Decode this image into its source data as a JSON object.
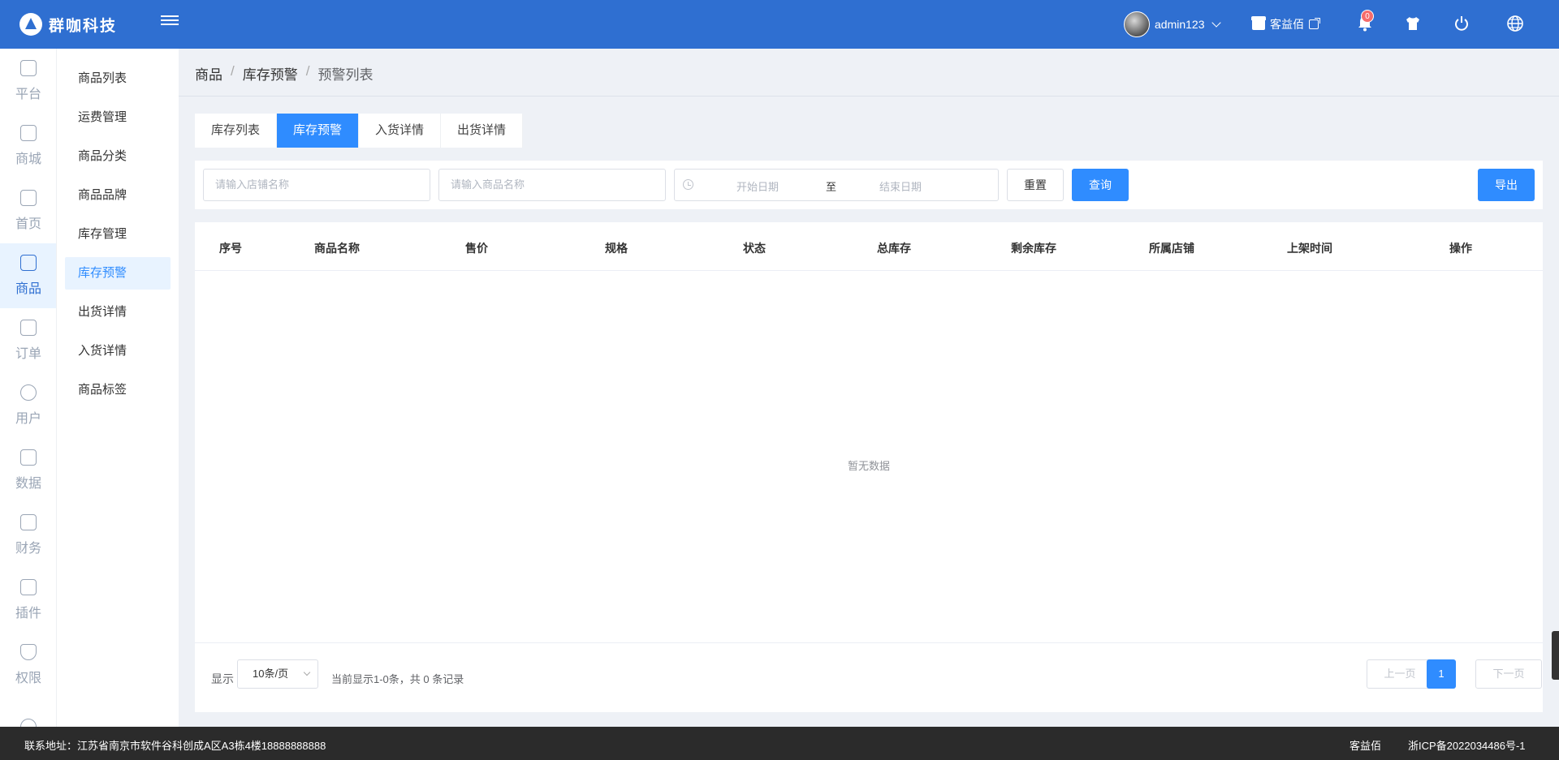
{
  "header": {
    "logo_text": "群咖科技",
    "username": "admin123",
    "store_name": "客益佰",
    "notification_count": "0"
  },
  "nav": [
    {
      "label": "平台",
      "icon": "platform-icon"
    },
    {
      "label": "商城",
      "icon": "mall-icon"
    },
    {
      "label": "首页",
      "icon": "home-icon"
    },
    {
      "label": "商品",
      "icon": "goods-icon",
      "active": true
    },
    {
      "label": "订单",
      "icon": "order-icon"
    },
    {
      "label": "用户",
      "icon": "user-icon"
    },
    {
      "label": "数据",
      "icon": "data-icon"
    },
    {
      "label": "财务",
      "icon": "finance-icon"
    },
    {
      "label": "插件",
      "icon": "plugin-icon"
    },
    {
      "label": "权限",
      "icon": "permission-icon"
    }
  ],
  "submenu": [
    {
      "label": "商品列表"
    },
    {
      "label": "运费管理"
    },
    {
      "label": "商品分类"
    },
    {
      "label": "商品品牌"
    },
    {
      "label": "库存管理"
    },
    {
      "label": "库存预警",
      "active": true
    },
    {
      "label": "出货详情"
    },
    {
      "label": "入货详情"
    },
    {
      "label": "商品标签"
    }
  ],
  "breadcrumb": [
    "商品",
    "库存预警",
    "预警列表"
  ],
  "tabs": [
    "库存列表",
    "库存预警",
    "入货详情",
    "出货详情"
  ],
  "filter": {
    "store_placeholder": "请输入店铺名称",
    "goods_placeholder": "请输入商品名称",
    "start_placeholder": "开始日期",
    "range_separator": "至",
    "end_placeholder": "结束日期",
    "reset_label": "重置",
    "search_label": "查询",
    "export_label": "导出"
  },
  "table": {
    "columns": [
      "序号",
      "商品名称",
      "售价",
      "规格",
      "状态",
      "总库存",
      "剩余库存",
      "所属店铺",
      "上架时间",
      "操作"
    ],
    "rows": [],
    "empty_text": "暂无数据"
  },
  "pagination": {
    "show_label": "显示",
    "page_size": "10条/页",
    "info": "当前显示1-0条，共 0 条记录",
    "prev_label": "上一页",
    "current_page": "1",
    "next_label": "下一页"
  },
  "footer": {
    "address": "联系地址：江苏省南京市软件谷科创成A区A3栋4楼18888888888",
    "brand": "客益佰",
    "icp": "浙ICP备2022034486号-1"
  },
  "colors": {
    "header_bg": "#2f6fd1",
    "primary": "#2f8cff",
    "badge": "#f56c6c",
    "footer_bg": "#2b2b2b"
  }
}
